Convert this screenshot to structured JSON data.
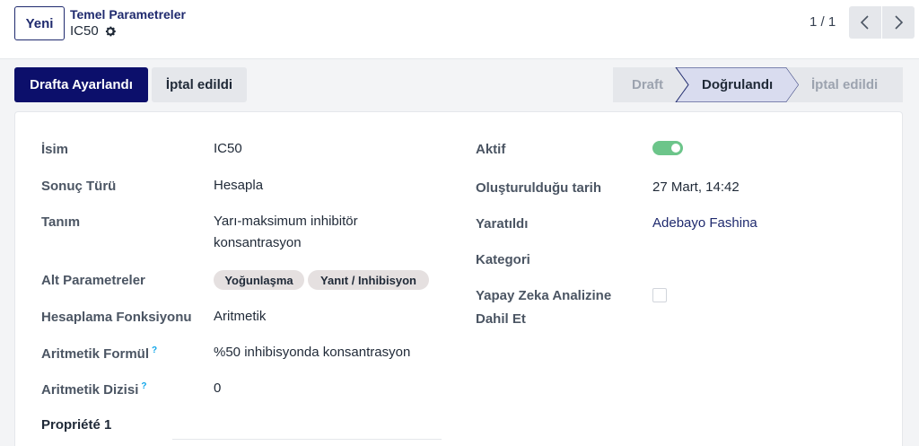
{
  "header": {
    "new_button": "Yeni",
    "breadcrumb_parent": "Temel Parametreler",
    "breadcrumb_current": "IC50",
    "pager": "1 / 1"
  },
  "actions": {
    "set_draft": "Drafta Ayarlandı",
    "cancelled": "İptal edildi"
  },
  "statusbar": {
    "stages": [
      "Draft",
      "Doğrulandı",
      "İptal edildi"
    ],
    "active": "Doğrulandı"
  },
  "form": {
    "left": {
      "name_label": "İsim",
      "name_value": "IC50",
      "result_type_label": "Sonuç Türü",
      "result_type_value": "Hesapla",
      "description_label": "Tanım",
      "description_line1": "Yarı-maksimum inhibitör",
      "description_line2": "konsantrasyon",
      "sub_params_label": "Alt Parametreler",
      "sub_params_tags": [
        "Yoğunlaşma",
        "Yanıt / Inhibisyon"
      ],
      "calc_function_label": "Hesaplama Fonksiyonu",
      "calc_function_value": "Aritmetik",
      "arith_formula_label": "Aritmetik Formül",
      "arith_formula_value": "%50 inhibisyonda konsantrasyon",
      "arith_sequence_label": "Aritmetik Dizisi",
      "arith_sequence_value": "0",
      "help_mark": "?"
    },
    "right": {
      "active_label": "Aktif",
      "active_value": true,
      "created_date_label": "Oluşturulduğu tarih",
      "created_date_value": "27 Mart, 14:42",
      "created_by_label": "Yaratıldı",
      "created_by_value": "Adebayo Fashina",
      "category_label": "Kategori",
      "ai_label_line1": "Yapay Zeka Analizine",
      "ai_label_line2": "Dahil Et",
      "ai_value": false
    },
    "section_title": "Propriété 1"
  },
  "colors": {
    "primary": "#0c0f6b",
    "toggle_on": "#6cc58a",
    "link": "#1f2a6e"
  }
}
